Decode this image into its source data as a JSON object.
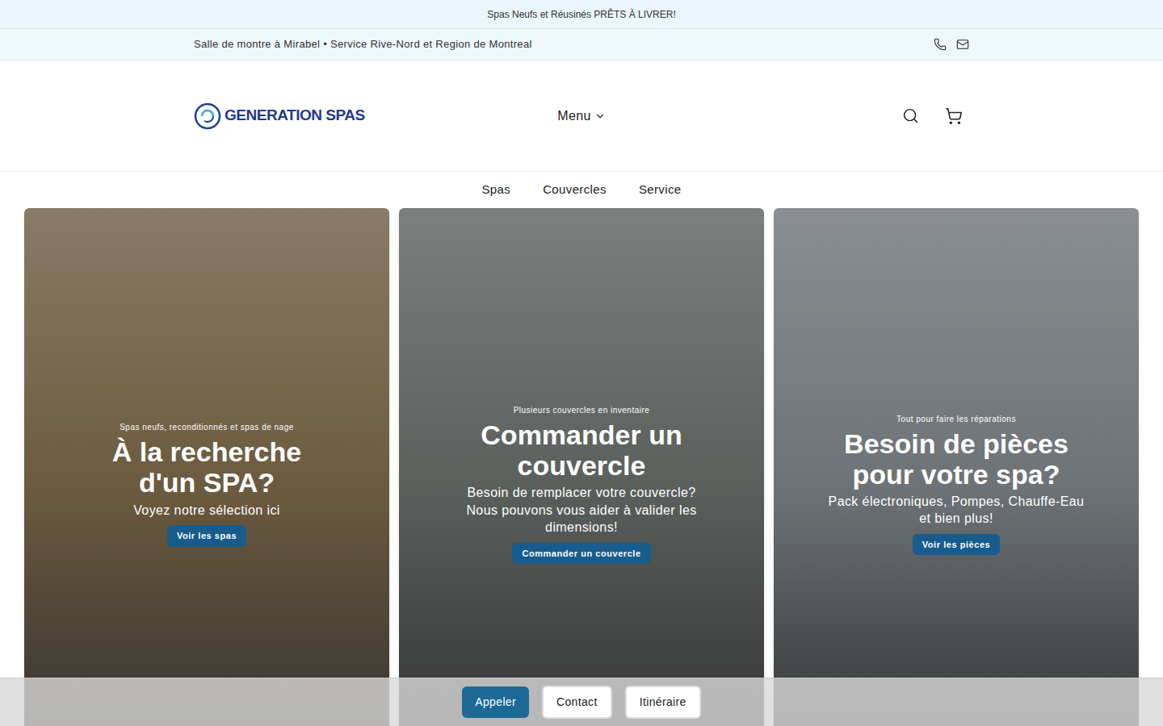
{
  "announcement": "Spas Neufs et Réusinés PRÊTS À LIVRER!",
  "info_bar": {
    "text": "Salle de montre à Mirabel • Service Rive-Nord et Region de Montreal"
  },
  "header": {
    "logo": "GENERATION SPAS",
    "menu": "Menu"
  },
  "nav": [
    "Spas",
    "Couvercles",
    "Service"
  ],
  "cards": [
    {
      "eyebrow": "Spas neufs, reconditionnés et spas de nage",
      "title": "À la recherche d'un SPA?",
      "subtitle": "Voyez notre sélection ici",
      "button": "Voir les spas",
      "color": "#6b5a3e"
    },
    {
      "eyebrow": "Plusieurs couvercles en inventaire",
      "title": "Commander un couvercle",
      "subtitle": "Besoin de remplacer votre couvercle? Nous pouvons vous aider à valider les dimensions!",
      "button": "Commander un couvercle",
      "color": "#5a5f5c"
    },
    {
      "eyebrow": "Tout pour faire les réparations",
      "title": "Besoin de pièces pour votre spa?",
      "subtitle": "Pack électroniques, Pompes, Chauffe-Eau et bien plus!",
      "button": "Voir les pièces",
      "color": "#6c7276"
    }
  ],
  "action_bar": [
    {
      "label": "Appeler",
      "kind": "primary"
    },
    {
      "label": "Contact",
      "kind": "secondary"
    },
    {
      "label": "Itinéraire",
      "kind": "secondary"
    }
  ]
}
